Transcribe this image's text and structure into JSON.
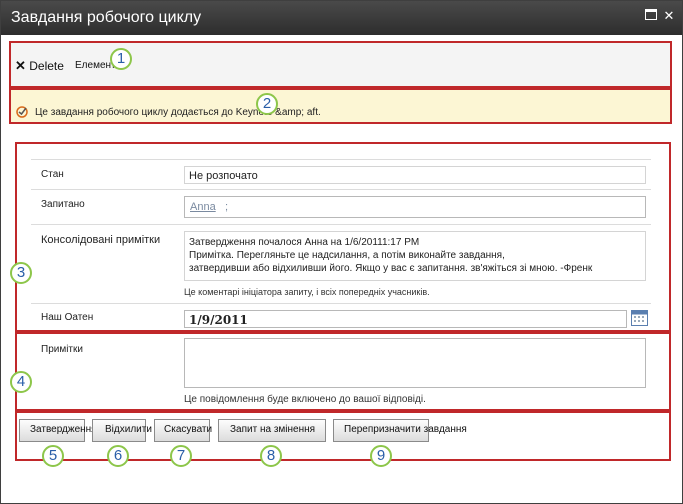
{
  "window": {
    "title": "Завдання робочого циклу"
  },
  "ribbon": {
    "delete_label": "Delete",
    "item_label": "Елемент"
  },
  "status": {
    "message": "Це завдання робочого циклу додається до Keynote &amp; aft."
  },
  "form": {
    "status_label": "Стан",
    "status_value": "Не розпочато",
    "requested_label": "Запитано",
    "requested_value": "Anna",
    "requested_sep": ";",
    "comments_label": "Консолідовані примітки",
    "comments_lines": [
      "Затвердження почалося Анна на 1/6/20111:17 PM",
      "Примітка. Перегляньте це надсилання, а потім виконайте завдання,",
      "затвердивши або відхиливши його. Якщо у вас є запитання. зв'яжіться зі мною. -Френк"
    ],
    "comments_hint": "Це коментарі ініціатора запиту, і всіх попередніх учасників.",
    "due_label": "Наш Оатен",
    "due_value": "1/9/2011",
    "notes_label": "Примітки",
    "notes_value": "",
    "notes_hint": "Це повідомлення буде включено до вашої відповіді."
  },
  "buttons": {
    "approve": "Затвердження",
    "reject": "Відхилити",
    "cancel": "Скасувати",
    "request_change": "Запит на змінення",
    "reassign": "Перепризначити завдання"
  },
  "callouts": [
    "1",
    "2",
    "3",
    "4",
    "5",
    "6",
    "7",
    "8",
    "9"
  ],
  "colors": {
    "callout_box": "#c0282a",
    "callout_circle": "#8dc64a",
    "status_bg": "#fcf6d4"
  }
}
